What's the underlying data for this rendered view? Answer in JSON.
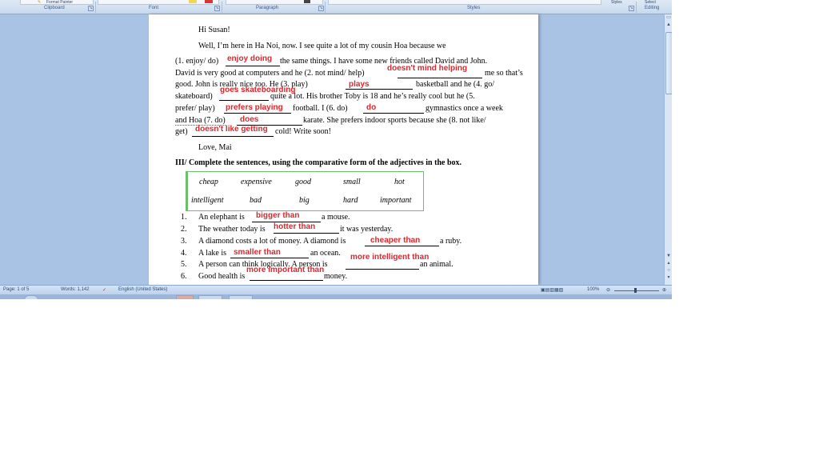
{
  "ribbon": {
    "groups": [
      "Clipboard",
      "Font",
      "Paragraph",
      "Styles",
      "Editing"
    ],
    "format_painter": "Format Painter",
    "styles_btn": "Styles",
    "select_btn": "Select"
  },
  "letter": {
    "greeting": "Hi Susan!",
    "p1": "Well, I’m here in Ha Noi, now. I see quite a lot of my cousin Hoa because we",
    "l1a": "(1. enjoy/ do)",
    "l1b": "the same things. I have some new friends called David and John.",
    "l2a": "David is very good at computers and he (2. not mind/ help)",
    "l2b": "me so that’s",
    "l3a": "good. John is really nice too. He (3. play)",
    "l3b": "basketball and he (4. go/",
    "l4a": "skateboard)",
    "l4b": "quite a lot. His brother Toby is 18 and he’s really cool but he (5.",
    "l5a": "prefer/ play)",
    "l5b": "football. I (6. do)",
    "l5c": "gymnastics once a week",
    "l6a": "and Hoa (7. do)",
    "l6b": "karate. She prefers indoor sports because she (8. not like/",
    "l7a": "get)",
    "l7b": "cold! Write soon!",
    "closing": "Love, Mai",
    "answers": {
      "a1": "enjoy doing",
      "a2": "doesn't mind helping",
      "a3": "plays",
      "a4": "goes skateboarding",
      "a5": "prefers playing",
      "a6": "do",
      "a7": "does",
      "a8": "doesn't like getting"
    }
  },
  "section3": {
    "heading": "III/ Complete the sentences, using the comparative form of the adjectives in the box.",
    "box_words": [
      "cheap",
      "expensive",
      "good",
      "small",
      "hot",
      "intelligent",
      "bad",
      "big",
      "hard",
      "important"
    ],
    "items": [
      {
        "num": "1.",
        "pre": "An elephant is",
        "answer": "bigger than",
        "post": "a mouse."
      },
      {
        "num": "2.",
        "pre": "The weather today is",
        "answer": "hotter than",
        "post": "it was yesterday."
      },
      {
        "num": "3.",
        "pre": "A diamond costs a lot of money. A diamond is",
        "answer": "cheaper than",
        "post": "a ruby."
      },
      {
        "num": "4.",
        "pre": "A lake is",
        "answer": "smaller than",
        "post": "an ocean."
      },
      {
        "num": "5.",
        "pre": "A person can think logically. A person is",
        "answer": "more intelligent than",
        "post": "an animal."
      },
      {
        "num": "6.",
        "pre": "Good health is",
        "answer": "more important than",
        "post": "money."
      }
    ]
  },
  "status": {
    "page": "Page: 1 of 5",
    "words": "Words: 1,142",
    "language": "English (United States)",
    "zoom": "100%"
  }
}
